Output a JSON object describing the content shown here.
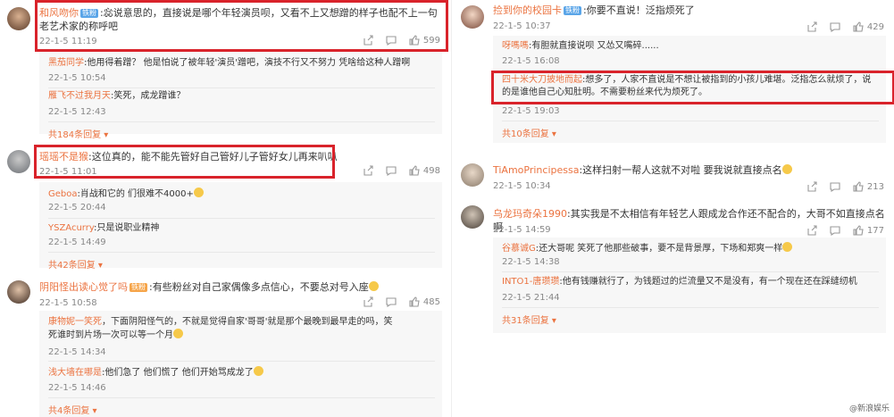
{
  "left": {
    "c1": {
      "user": "和风吻你",
      "badge": "铁粉",
      "text": ":惢说意思的，直接说是哪个年轻演员呗，又看不上又想蹭的样子也配不上一句老艺术家的称呼吧",
      "time": "22-1-5 11:19",
      "likes": "599",
      "replies": [
        {
          "user": "黑茄同学",
          "text": ":他用得着蹭？ 他是怕说了被年轻'演员'蹭吧，演技不行又不努力 凭啥给这种人蹭啊",
          "time": "22-1-5 10:54"
        },
        {
          "user": "雁飞不过我月天",
          "text": ":笑死，成龙蹭谁？",
          "time": "22-1-5 12:43"
        }
      ],
      "more": "共184条回复"
    },
    "c2": {
      "user": "瑶瑶不是猴",
      "text": ":这位真的，能不能先管好自己管好儿子管好女儿再来叭叭",
      "time": "22-1-5 11:01",
      "likes": "498",
      "replies": [
        {
          "user": "Geboa",
          "text": ":肖战和它的 们很难不4000+",
          "time": "22-1-5 20:44"
        },
        {
          "user": "YSZAcurry",
          "text": ":只是说职业精神",
          "time": "22-1-5 14:49"
        }
      ],
      "more": "共42条回复"
    },
    "c3": {
      "user": "阴阳怪出读心觉了吗",
      "badge": "铁粉",
      "text": ":有些粉丝对自己家偶像多点信心，不要总对号入座",
      "time": "22-1-5 10:58",
      "likes": "485",
      "replies": [
        {
          "user": "康物妮一笑死",
          "text": "，下面阴阳怪气的，不就是觉得自家'哥哥'就是那个最晚到最早走的吗，笑死谁时到片场一次可以等一个月",
          "time": "22-1-5 14:34"
        },
        {
          "user": "浅大墙在哪是",
          "text": ":他们急了 他们慌了 他们开始骂成龙了",
          "time": "22-1-5 14:46"
        }
      ],
      "more": "共4条回复"
    }
  },
  "right": {
    "c1": {
      "user": "捡到你的校园卡",
      "badge": "铁粉",
      "text": ":你要不直说！泛指烦死了",
      "time": "22-1-5 10:37",
      "likes": "429",
      "replies": [
        {
          "user": "呀嗎嗎",
          "text": ":有胆就直接说呗 又怂又嘴碎......",
          "time": "22-1-5 16:08"
        },
        {
          "user": "四十米大刀披地而起",
          "text": ":想多了，人家不直说是不想让被指到的小孩儿难堪。泛指怎么就烦了，说的是谁他自己心知肚明。不需要粉丝来代为烦死了。",
          "time": "22-1-5 19:03"
        }
      ],
      "more": "共10条回复"
    },
    "c2": {
      "user": "TiAmoPrincipessa",
      "text": ":这样扫射一帮人这就不对啦 要我说就直接点名",
      "time": "22-1-5 10:34",
      "likes": "213"
    },
    "c3": {
      "user": "乌龙玛奇朵1990",
      "text": ":其实我是不太相信有年轻艺人跟成龙合作还不配合的，大哥不如直接点名啊",
      "time": "22-1-5 14:59",
      "likes": "177",
      "replies": [
        {
          "user": "谷慕诚G",
          "text": ":还大哥呢 笑死了他那些破事，要不是背景厚，下场和郑爽一样",
          "time": "22-1-5 14:38"
        },
        {
          "user": "INTO1-唐瓒瓒",
          "text": ":他有钱赚就行了，为钱题过的烂流量又不是没有，有一个现在还在踩缝纫机",
          "time": "22-1-5 21:44"
        }
      ],
      "more": "共31条回复"
    }
  },
  "watermark": "@新浪娱乐"
}
